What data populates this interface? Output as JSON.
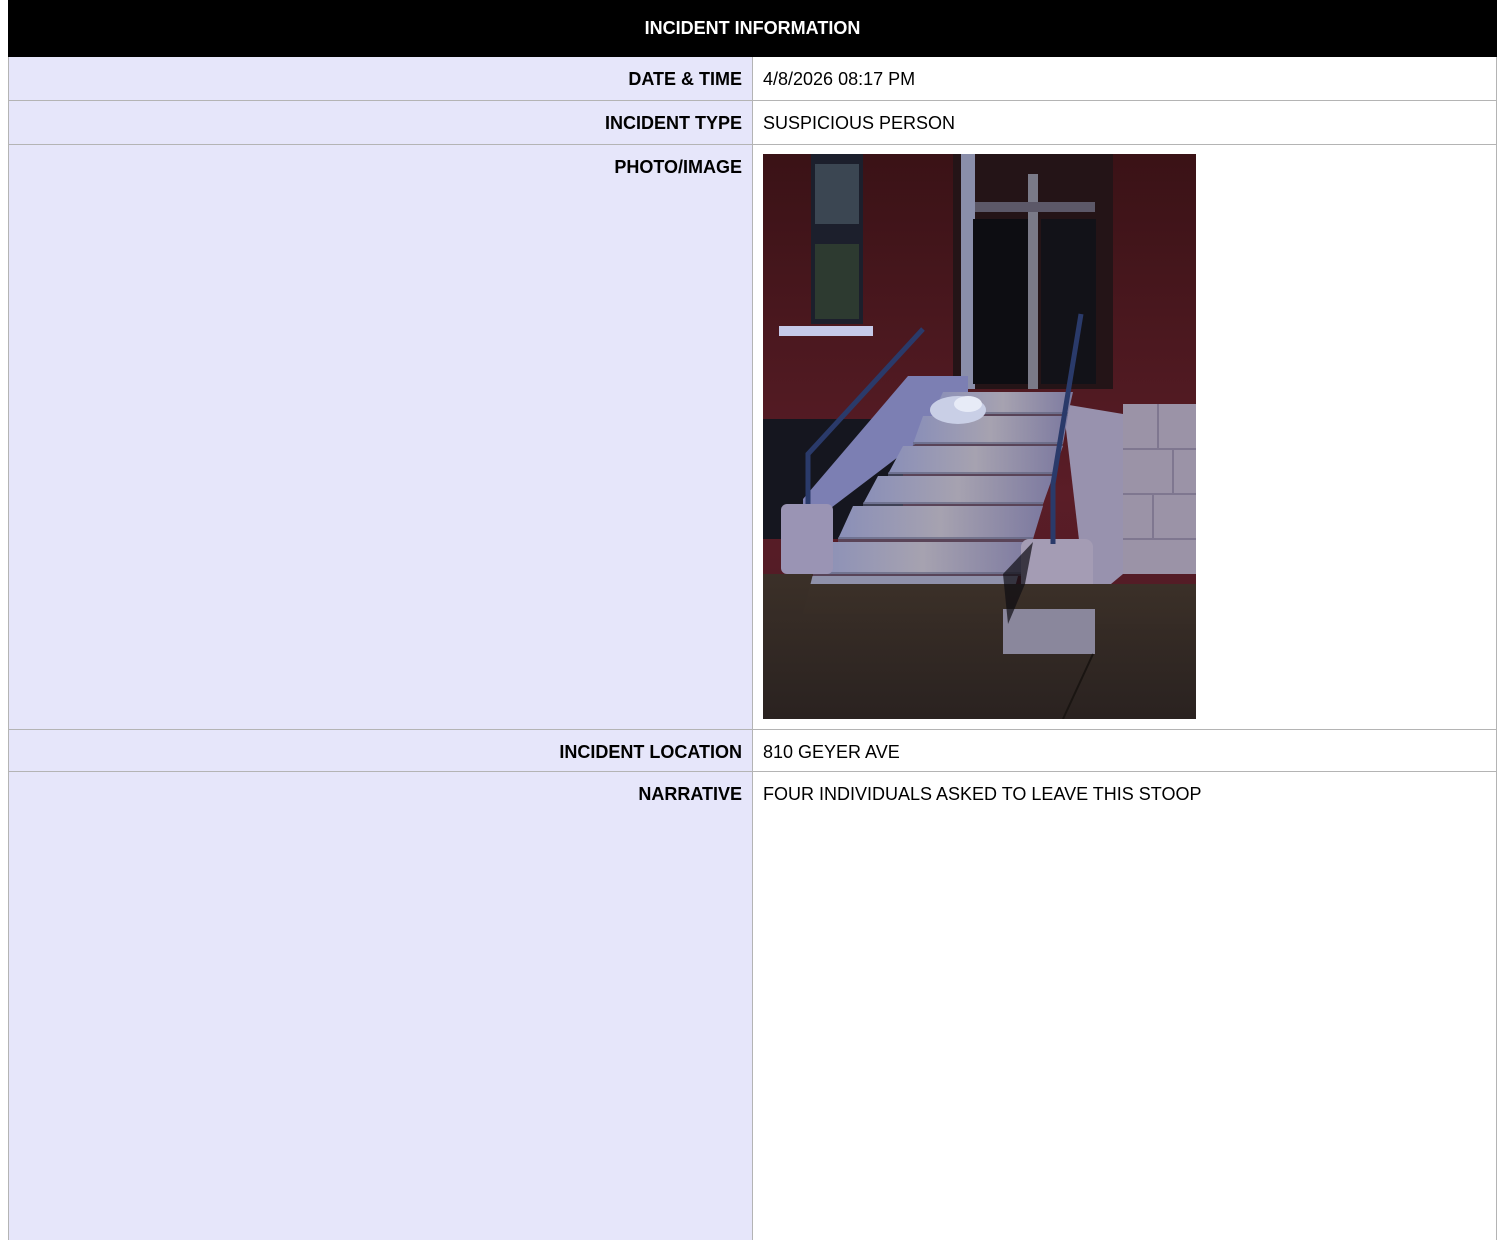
{
  "header": {
    "title": "INCIDENT INFORMATION"
  },
  "fields": {
    "date_time": {
      "label": "DATE & TIME",
      "value": "4/8/2026 08:17 PM"
    },
    "incident_type": {
      "label": "INCIDENT TYPE",
      "value": "SUSPICIOUS PERSON"
    },
    "photo": {
      "label": "PHOTO/IMAGE"
    },
    "location": {
      "label": "INCIDENT LOCATION",
      "value": "810 GEYER AVE"
    },
    "narrative": {
      "label": "NARRATIVE",
      "value": "FOUR INDIVIDUALS ASKED TO LEAVE THIS STOOP"
    }
  },
  "colors": {
    "header_bg": "#000000",
    "label_bg": "#e6e6fa",
    "border": "#b4b4b4"
  }
}
